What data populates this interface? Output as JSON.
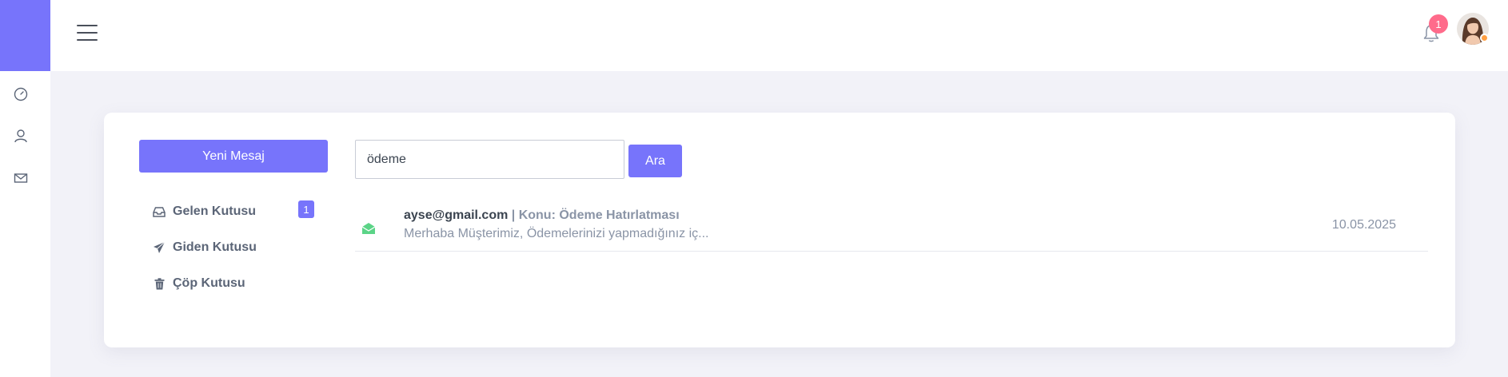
{
  "rail": {
    "items": [
      "dashboard-icon",
      "user-icon",
      "mail-icon"
    ]
  },
  "header": {
    "notifications_count": "1",
    "avatar": "user-avatar"
  },
  "mailbox": {
    "new_message_label": "Yeni Mesaj",
    "folders": [
      {
        "label": "Gelen Kutusu",
        "icon": "inbox-icon",
        "count": "1"
      },
      {
        "label": "Giden Kutusu",
        "icon": "send-icon"
      },
      {
        "label": "Çöp Kutusu",
        "icon": "trash-icon"
      }
    ]
  },
  "search": {
    "value": "ödeme",
    "button_label": "Ara"
  },
  "messages": [
    {
      "icon": "envelope-open-icon",
      "sender": "ayse@gmail.com",
      "separator": " | ",
      "subject": "Konu: Ödeme Hatırlatması",
      "preview": "Merhaba Müşterimiz, Ödemelerinizi yapmadığınız iç...",
      "date": "10.05.2025"
    }
  ],
  "colors": {
    "accent": "#7774fb",
    "badge_pink": "#ff6b8b",
    "status_orange": "#ff9f43",
    "read_icon_green": "#5bd487",
    "background": "#f2f2f8"
  }
}
